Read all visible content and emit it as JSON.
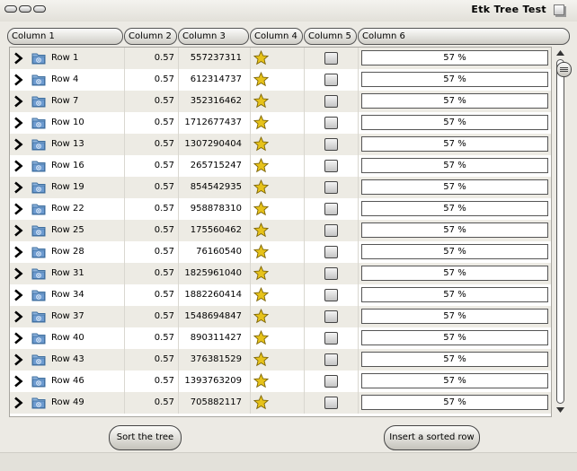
{
  "window": {
    "title": "Etk Tree Test"
  },
  "columns": [
    "Column 1",
    "Column 2",
    "Column 3",
    "Column 4",
    "Column 5",
    "Column 6"
  ],
  "rows": [
    {
      "label": "Row 1",
      "col2": "0.57",
      "col3": "557237311",
      "progress": "57 %",
      "progress_value": 0.57
    },
    {
      "label": "Row 4",
      "col2": "0.57",
      "col3": "612314737",
      "progress": "57 %",
      "progress_value": 0.57
    },
    {
      "label": "Row 7",
      "col2": "0.57",
      "col3": "352316462",
      "progress": "57 %",
      "progress_value": 0.57
    },
    {
      "label": "Row 10",
      "col2": "0.57",
      "col3": "1712677437",
      "progress": "57 %",
      "progress_value": 0.57
    },
    {
      "label": "Row 13",
      "col2": "0.57",
      "col3": "1307290404",
      "progress": "57 %",
      "progress_value": 0.57
    },
    {
      "label": "Row 16",
      "col2": "0.57",
      "col3": "265715247",
      "progress": "57 %",
      "progress_value": 0.57
    },
    {
      "label": "Row 19",
      "col2": "0.57",
      "col3": "854542935",
      "progress": "57 %",
      "progress_value": 0.57
    },
    {
      "label": "Row 22",
      "col2": "0.57",
      "col3": "958878310",
      "progress": "57 %",
      "progress_value": 0.57
    },
    {
      "label": "Row 25",
      "col2": "0.57",
      "col3": "175560462",
      "progress": "57 %",
      "progress_value": 0.57
    },
    {
      "label": "Row 28",
      "col2": "0.57",
      "col3": "76160540",
      "progress": "57 %",
      "progress_value": 0.57
    },
    {
      "label": "Row 31",
      "col2": "0.57",
      "col3": "1825961040",
      "progress": "57 %",
      "progress_value": 0.57
    },
    {
      "label": "Row 34",
      "col2": "0.57",
      "col3": "1882260414",
      "progress": "57 %",
      "progress_value": 0.57
    },
    {
      "label": "Row 37",
      "col2": "0.57",
      "col3": "1548694847",
      "progress": "57 %",
      "progress_value": 0.57
    },
    {
      "label": "Row 40",
      "col2": "0.57",
      "col3": "890311427",
      "progress": "57 %",
      "progress_value": 0.57
    },
    {
      "label": "Row 43",
      "col2": "0.57",
      "col3": "376381529",
      "progress": "57 %",
      "progress_value": 0.57
    },
    {
      "label": "Row 46",
      "col2": "0.57",
      "col3": "1393763209",
      "progress": "57 %",
      "progress_value": 0.57
    },
    {
      "label": "Row 49",
      "col2": "0.57",
      "col3": "705882117",
      "progress": "57 %",
      "progress_value": 0.57
    }
  ],
  "icons": {
    "expander": "chevron-right-icon",
    "row_icon": "folder-icon",
    "col4": "star-icon",
    "col5": "checkbox"
  },
  "buttons": {
    "sort": "Sort the tree",
    "insert": "Insert a sorted row"
  },
  "colors": {
    "star": "#e6c21a",
    "folder": "#5b8fc7",
    "odd_row": "#edebe4"
  }
}
